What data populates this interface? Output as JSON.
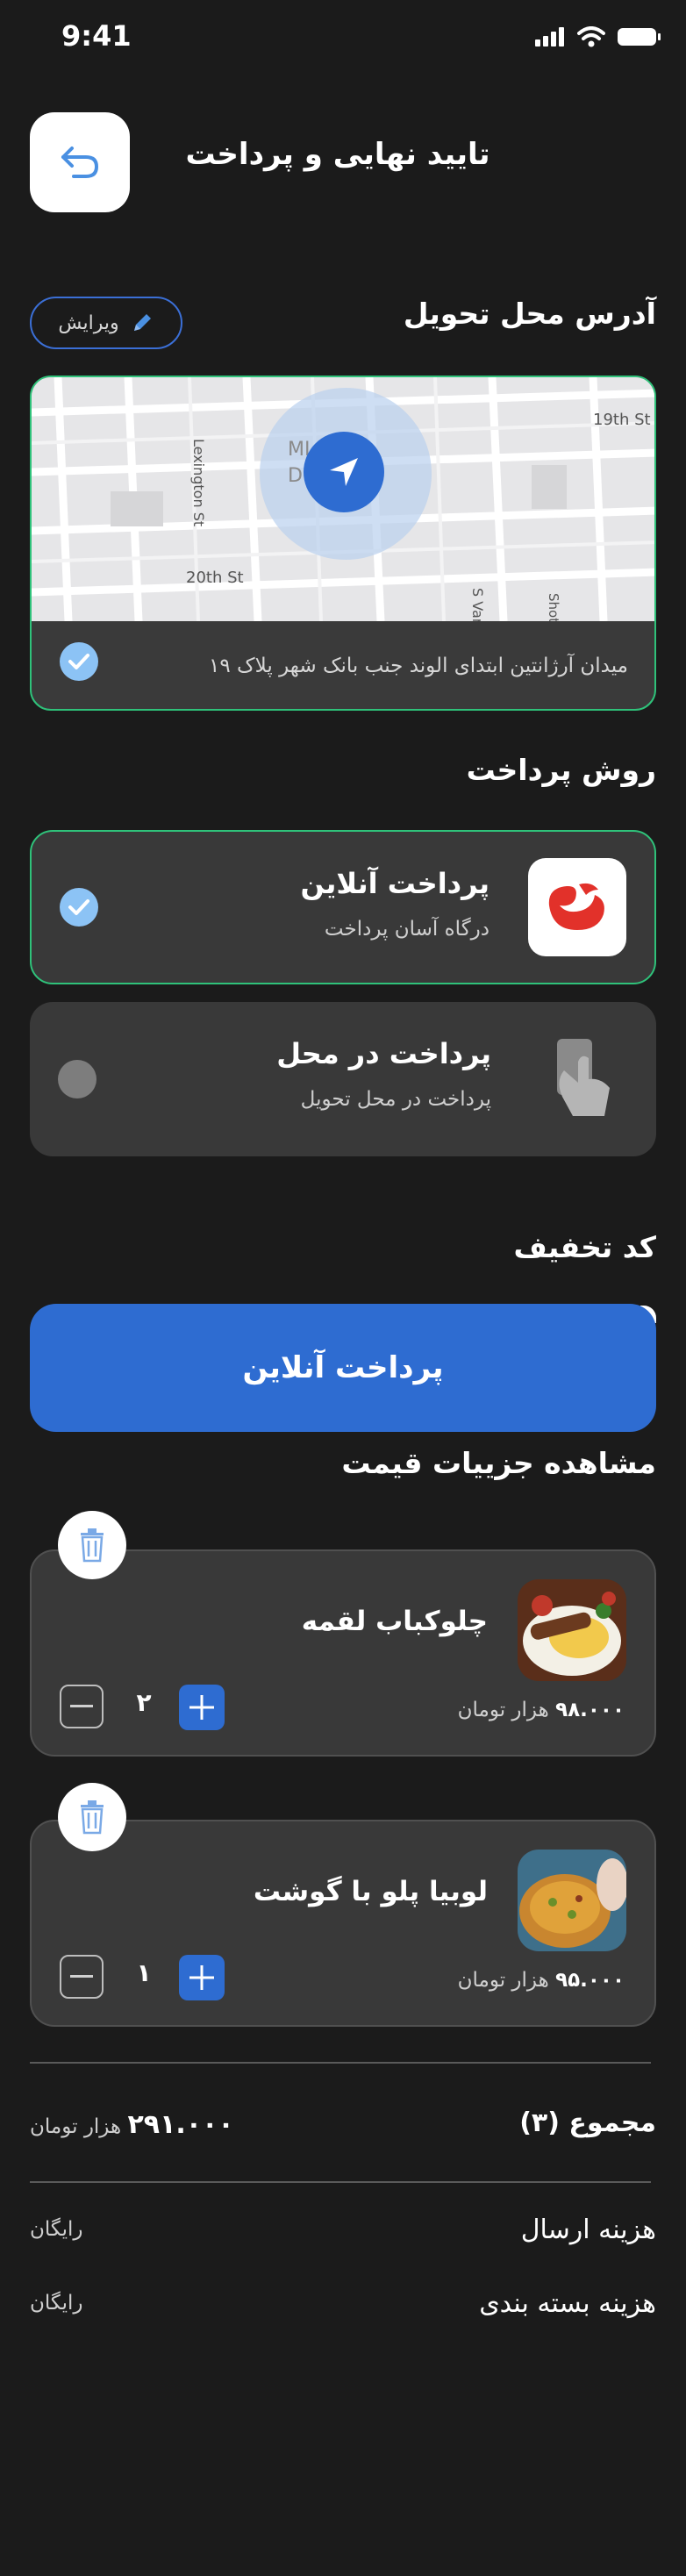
{
  "status_bar": {
    "time": "9:41"
  },
  "header": {
    "title": "تایید نهایی و پرداخت",
    "back_icon": "undo-arrow-icon"
  },
  "address": {
    "section_title": "آدرس محل تحویل",
    "edit_label": "ویرایش",
    "text": "میدان آرژانتین ابتدای الوند جنب بانک شهر پلاک ۱۹",
    "map_labels": {
      "street_19th": "19th St",
      "street_20th": "20th St",
      "lexington": "Lexington St",
      "svan": "S Van Ness",
      "shotwell": "Shotwell",
      "district_1": "MI  ON",
      "district_2": "D     T"
    }
  },
  "payment": {
    "section_title": "روش پرداخت",
    "methods": [
      {
        "title": "پرداخت آنلاین",
        "subtitle": "درگاه آسان پرداخت",
        "selected": true
      },
      {
        "title": "پرداخت در محل",
        "subtitle": "پرداخت در محل تحویل",
        "selected": false
      }
    ]
  },
  "discount": {
    "section_title": "کد تخفیف"
  },
  "online_button": {
    "label": "پرداخت آنلاین"
  },
  "price_details": {
    "section_title": "مشاهده جزییات قیمت"
  },
  "cart": {
    "items": [
      {
        "name": "چلوکباب لقمه",
        "price": "۹۸.۰۰۰",
        "unit": "هزار تومان",
        "qty": "۲"
      },
      {
        "name": "لوبیا پلو با گوشت",
        "price": "۹۵.۰۰۰",
        "unit": "هزار تومان",
        "qty": "۱"
      }
    ]
  },
  "summary": {
    "total_label": "مجموع (۳)",
    "total_value": "۲۹۱.۰۰۰",
    "total_unit": "هزار تومان",
    "shipping_label": "هزینه ارسال",
    "shipping_value": "رایگان",
    "packaging_label": "هزینه بسته بندی",
    "packaging_value": "رایگان"
  },
  "colors": {
    "background": "#1b1b1b",
    "card": "#393939",
    "accent": "#2e6cd1",
    "success_border": "#2fc27a",
    "check": "#8cc3f5"
  }
}
